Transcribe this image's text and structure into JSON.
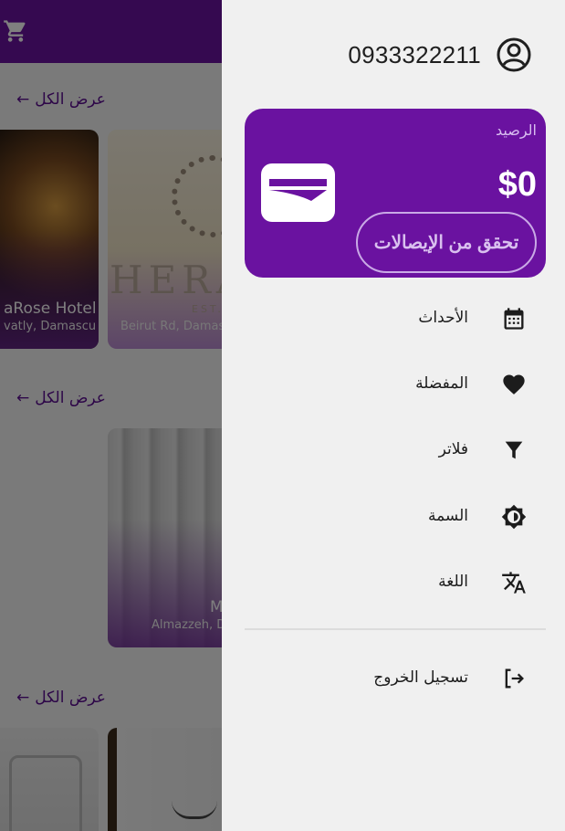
{
  "background": {
    "sections": [
      {
        "see_all": "عرض الكل",
        "arrow": "←",
        "cards": [
          {
            "title": "aRose Hotel",
            "address": "vatly, Damascu"
          },
          {
            "title": "",
            "address": "Beirut Rd, Damas"
          }
        ]
      },
      {
        "see_all": "عرض الكل",
        "arrow": "←",
        "cards": [
          {
            "title": "M",
            "address": "Almazzeh, D"
          }
        ]
      },
      {
        "see_all": "عرض الكل",
        "arrow": "←",
        "cards": []
      }
    ],
    "logo_partial": "HERA",
    "logo_sub": "EST."
  },
  "drawer": {
    "phone": "0933322211",
    "balance": {
      "label": "الرصيد",
      "amount": "$0",
      "check_button": "تحقق من الإيصالات"
    },
    "menu": [
      {
        "label": "الأحداث",
        "icon": "calendar-icon"
      },
      {
        "label": "المفضلة",
        "icon": "heart-icon"
      },
      {
        "label": "فلاتر",
        "icon": "filter-icon"
      },
      {
        "label": "السمة",
        "icon": "theme-icon"
      },
      {
        "label": "اللغة",
        "icon": "translate-icon"
      }
    ],
    "logout": {
      "label": "تسجيل الخروج",
      "icon": "logout-icon"
    }
  },
  "colors": {
    "primary": "#6a12a0",
    "drawer_bg": "#f0f0f0",
    "scrim": "rgba(0,0,0,0.5)"
  }
}
